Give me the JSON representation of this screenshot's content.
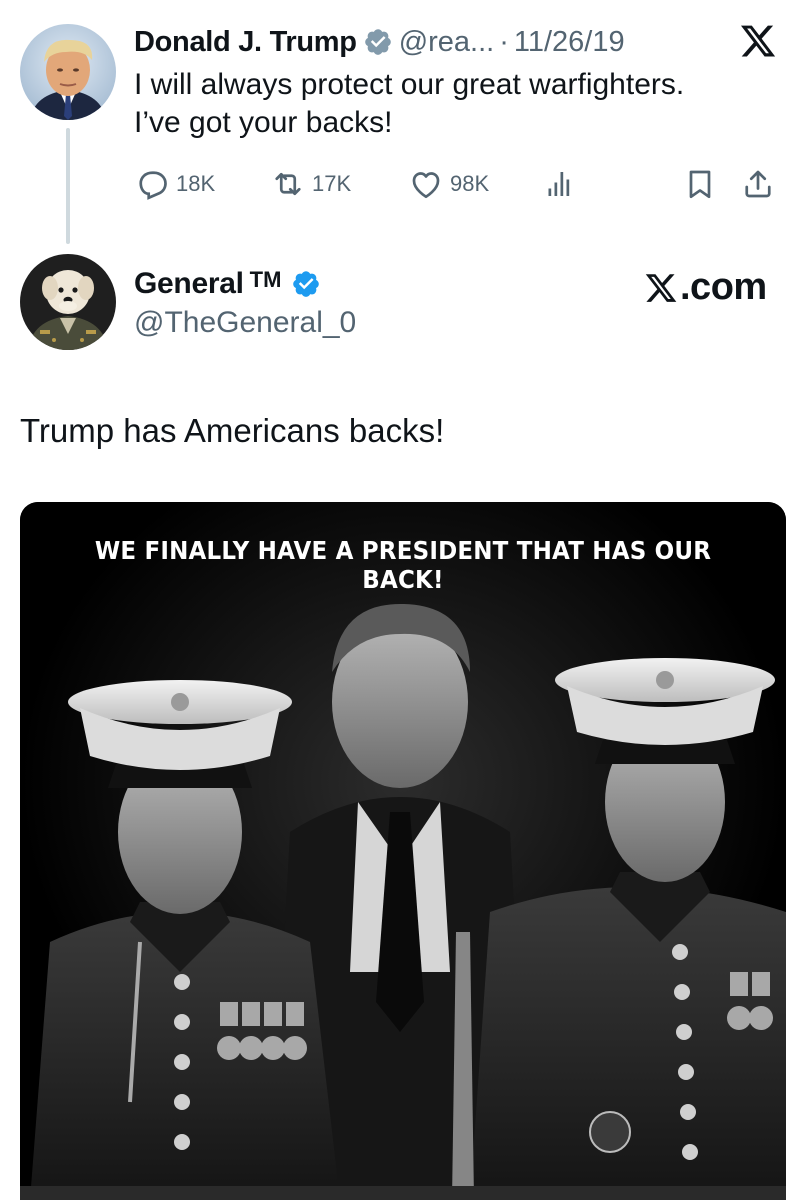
{
  "parent_tweet": {
    "display_name": "Donald J. Trump",
    "handle": "@rea...",
    "separator": "·",
    "date": "11/26/19",
    "text_lines": [
      "I will always protect our great warfighters.",
      "I’ve got your backs!"
    ],
    "actions": {
      "reply_count": "18K",
      "repost_count": "17K",
      "like_count": "98K"
    },
    "icons": [
      "verified-badge-icon",
      "x-logo-icon",
      "reply-icon",
      "repost-icon",
      "like-icon",
      "views-icon",
      "bookmark-icon",
      "share-icon"
    ]
  },
  "main_tweet": {
    "display_name": "General",
    "name_suffix": "TM",
    "handle": "@TheGeneral_0",
    "site_label": ".com",
    "text": "Trump has Americans backs!",
    "media_caption": "WE FINALLY HAVE A PRESIDENT THAT HAS OUR BACK!"
  },
  "colors": {
    "verified_blue": "#1d9bf0",
    "secondary_text": "#536471",
    "thread_line": "#cfd9de"
  }
}
